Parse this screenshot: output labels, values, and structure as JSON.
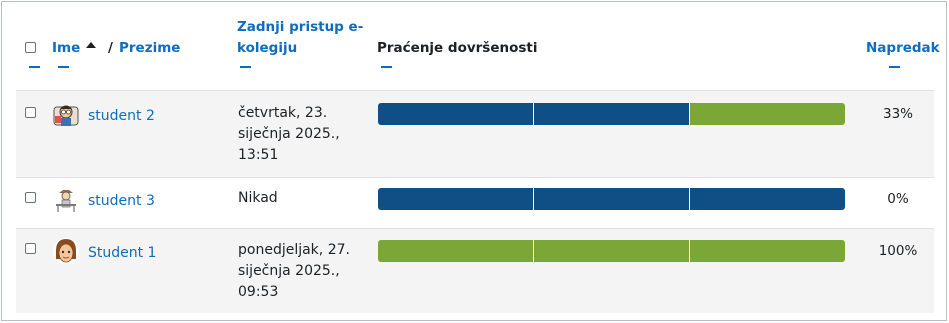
{
  "header": {
    "first_name": "Ime",
    "separator": "/",
    "last_name": "Prezime",
    "last_access_line1": "Zadnji pristup e-",
    "last_access_line2": "kolegiju",
    "completion_tracking": "Praćenje dovršenosti",
    "progress": "Napredak"
  },
  "colors": {
    "complete": "#7ba736",
    "incomplete": "#0f4f85",
    "link": "#0f6cbf"
  },
  "rows": [
    {
      "name": "student 2",
      "access_line1": "četvrtak, 23.",
      "access_line2": "siječnja 2025.,",
      "access_line3": "13:51",
      "progress": "33%",
      "segments": [
        "incomplete",
        "incomplete",
        "complete"
      ]
    },
    {
      "name": "student 3",
      "access_line1": "Nikad",
      "progress": "0%",
      "segments": [
        "incomplete",
        "incomplete",
        "incomplete"
      ]
    },
    {
      "name": "Student 1",
      "access_line1": "ponedjeljak, 27.",
      "access_line2": "siječnja 2025.,",
      "access_line3": "09:53",
      "progress": "100%",
      "segments": [
        "complete",
        "complete",
        "complete"
      ]
    }
  ]
}
